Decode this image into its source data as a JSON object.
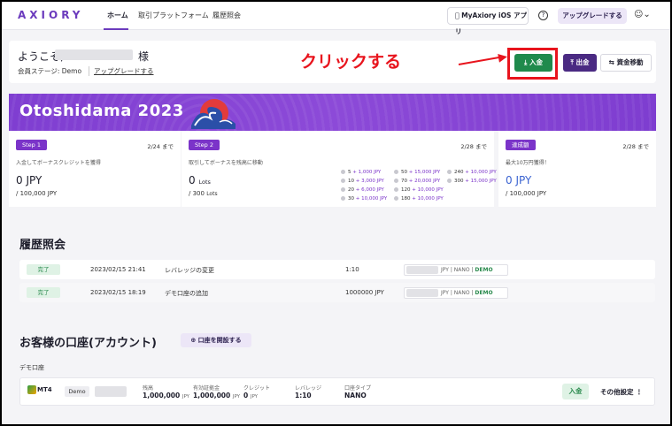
{
  "header": {
    "logo": "AXIORY",
    "nav": [
      "ホーム",
      "取引プラットフォーム",
      "履歴照会"
    ],
    "ios_button": "MyAxiory iOS アプリ",
    "help": "?",
    "upgrade_button": "アップグレードする"
  },
  "welcome": {
    "greeting": "ようこそ,",
    "sama": "様",
    "member_stage": "会員ステージ: Demo",
    "upgrade_link": "アップグレードする"
  },
  "annotation": {
    "text": "クリックする"
  },
  "actions": {
    "deposit": "入金",
    "withdraw": "出金",
    "transfer": "資金移動"
  },
  "promo": {
    "title": "Otoshidama 2023",
    "step1": {
      "badge": "Step 1",
      "date": "2/24 まで",
      "desc": "入金してボーナスクレジットを獲得",
      "value": "0 JPY",
      "sub": "/ 100,000 JPY"
    },
    "step2": {
      "badge": "Step 2",
      "date": "2/28 まで",
      "desc": "取引してボーナスを残高に移動",
      "value": "0",
      "value_unit": "Lots",
      "sub": "/ 300",
      "sub_unit": "Lots"
    },
    "step3": {
      "badge": "達成額",
      "date": "2/28 まで",
      "desc": "最大10万円獲得！",
      "value": "0 JPY",
      "sub": "/ 100,000 JPY"
    },
    "lots": [
      [
        {
          "lots": "5",
          "bonus": "+ 1,000 JPY"
        },
        {
          "lots": "50",
          "bonus": "+ 15,000 JPY"
        },
        {
          "lots": "240",
          "bonus": "+ 10,000 JPY"
        }
      ],
      [
        {
          "lots": "10",
          "bonus": "+ 3,000 JPY"
        },
        {
          "lots": "70",
          "bonus": "+ 20,000 JPY"
        },
        {
          "lots": "300",
          "bonus": "+ 15,000 JPY"
        }
      ],
      [
        {
          "lots": "20",
          "bonus": "+ 6,000 JPY"
        },
        {
          "lots": "120",
          "bonus": "+ 10,000 JPY"
        }
      ],
      [
        {
          "lots": "30",
          "bonus": "+ 10,000 JPY"
        },
        {
          "lots": "180",
          "bonus": "+ 10,000 JPY"
        }
      ]
    ]
  },
  "history": {
    "title": "履歴照会",
    "rows": [
      {
        "status": "完了",
        "datetime": "2023/02/15 21:41",
        "action": "レバレッジの変更",
        "value": "1:10",
        "tag_currency": "JPY",
        "tag_type": "NANO",
        "tag_mode": "DEMO"
      },
      {
        "status": "完了",
        "datetime": "2023/02/15 18:19",
        "action": "デモ口座の追加",
        "value": "1000000 JPY",
        "tag_currency": "JPY",
        "tag_type": "NANO",
        "tag_mode": "DEMO"
      }
    ]
  },
  "accounts": {
    "title": "お客様の口座(アカウント)",
    "open_button": "口座を開設する",
    "demo_label": "デモ口座",
    "card": {
      "platform": "MT4",
      "mode": "Demo",
      "balance_label": "残高",
      "balance": "1,000,000",
      "balance_unit": "JPY",
      "margin_label": "有効証拠金",
      "margin": "1,000,000",
      "margin_unit": "JPY",
      "credit_label": "クレジット",
      "credit": "0",
      "credit_unit": "JPY",
      "leverage_label": "レバレッジ",
      "leverage": "1:10",
      "type_label": "口座タイプ",
      "type": "NANO",
      "deposit_button": "入金",
      "more_button": "その他設定"
    }
  },
  "colors": {
    "brand": "#6b3bbd",
    "deposit_green": "#1f8a4c",
    "withdraw_purple": "#4a2a82",
    "annotation_red": "#e8141d",
    "banner_purple": "#8c4ad8"
  }
}
